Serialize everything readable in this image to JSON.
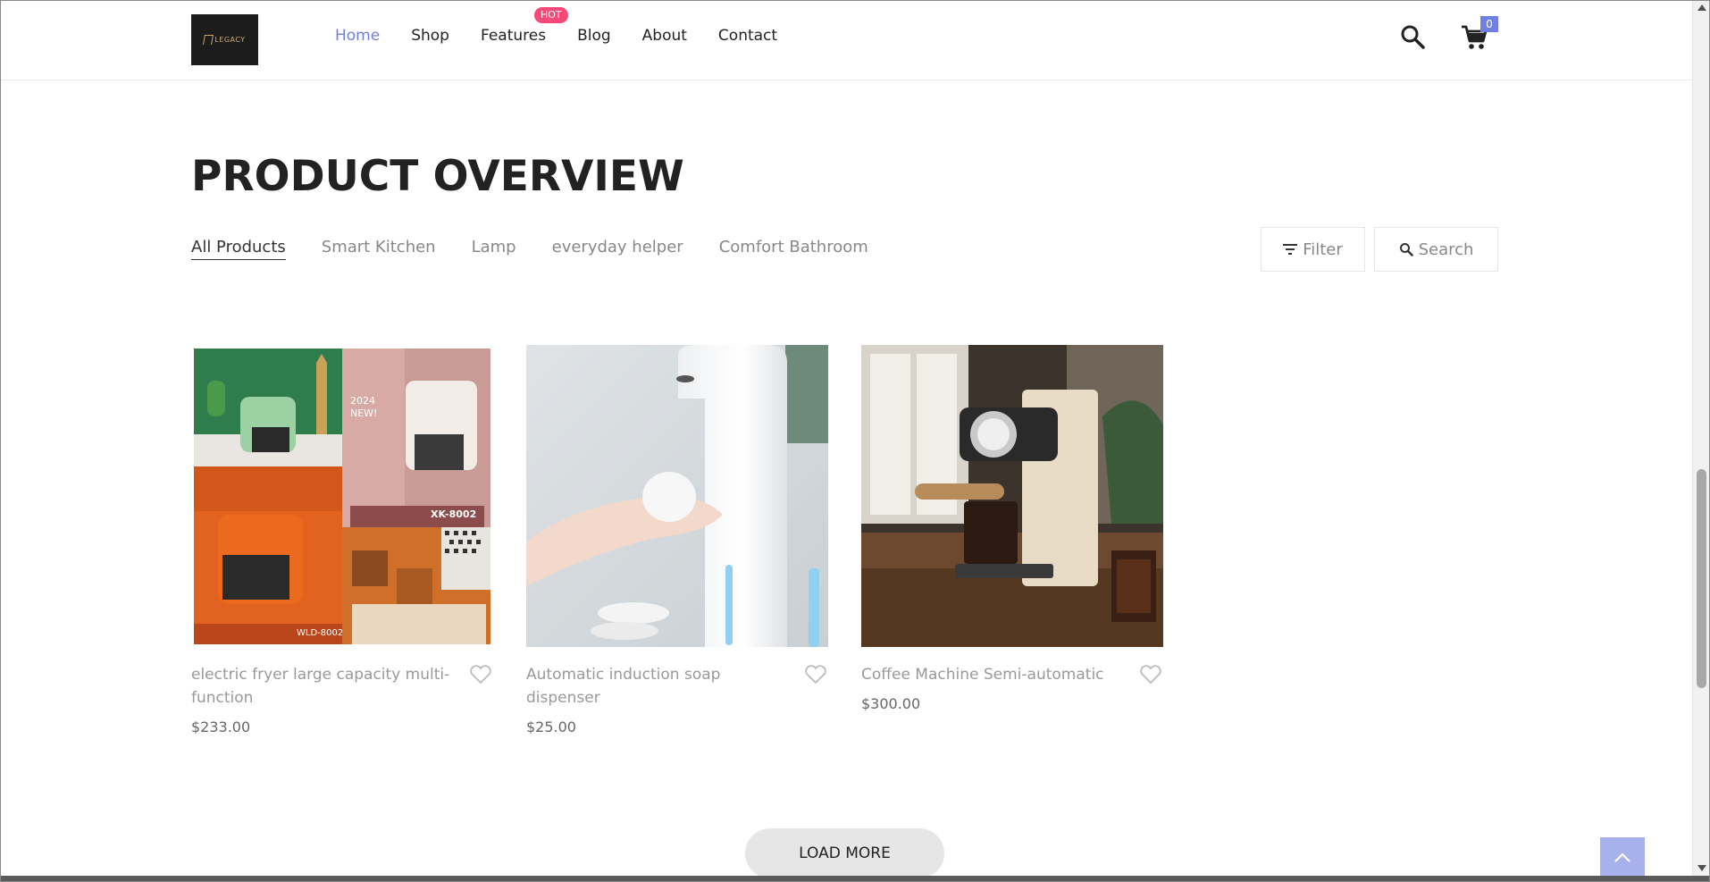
{
  "header": {
    "logo_text": "LEGACY",
    "nav": [
      {
        "label": "Home"
      },
      {
        "label": "Shop"
      },
      {
        "label": "Features",
        "badge": "HOT"
      },
      {
        "label": "Blog"
      },
      {
        "label": "About"
      },
      {
        "label": "Contact"
      }
    ],
    "cart_count": "0",
    "icons": [
      "search-icon",
      "cart-icon"
    ]
  },
  "page_title": "PRODUCT OVERVIEW",
  "categories": [
    "All Products",
    "Smart Kitchen",
    "Lamp",
    "everyday helper",
    "Comfort Bathroom"
  ],
  "active_category": "All Products",
  "tools": {
    "filter_label": "Filter",
    "search_label": "Search"
  },
  "products": [
    {
      "name": "electric fryer large capacity multi-function",
      "price": "$233.00",
      "image_text": [
        "2024",
        "NEW!",
        "XK-8002",
        "WLD-8002"
      ]
    },
    {
      "name": "Automatic induction soap dispenser",
      "price": "$25.00"
    },
    {
      "name": "Coffee Machine Semi-automatic",
      "price": "$300.00"
    }
  ],
  "load_more_label": "LOAD MORE",
  "colors": {
    "accent": "#717fe0",
    "hot_badge": "#f74877",
    "back_to_top": "#a9b1ec"
  }
}
